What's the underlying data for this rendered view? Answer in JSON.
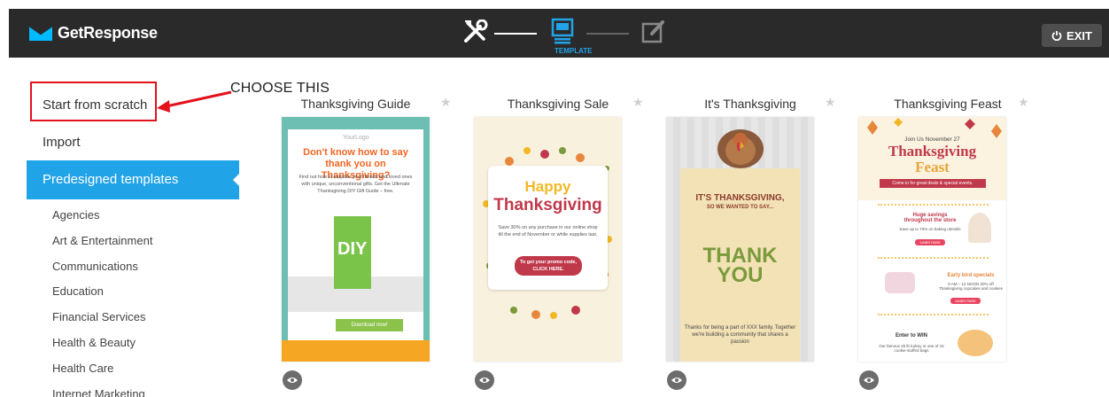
{
  "header": {
    "logo_text": "GetResponse",
    "step_active_label": "TEMPLATE",
    "exit_label": "EXIT",
    "colors": {
      "bar": "#2a2a2b",
      "accent": "#21a3e8"
    }
  },
  "sidebar": {
    "start_from_scratch": "Start from scratch",
    "import": "Import",
    "predesigned": "Predesigned templates",
    "categories": [
      "Agencies",
      "Art & Entertainment",
      "Communications",
      "Education",
      "Financial Services",
      "Health & Beauty",
      "Health Care",
      "Internet Marketing"
    ]
  },
  "annotation": {
    "text": "CHOOSE THIS",
    "color": "#e3111b"
  },
  "templates": [
    {
      "title": "Thanksgiving Guide",
      "logo": "YourLogo",
      "headline": "Don't know how to say thank you on Thanksgiving?",
      "body": "Find out how to surprise your friends and loved ones with unique, unconventional gifts. Get the Ultimate Thanksgiving DIY Gift Guide – free.",
      "book": "DIY",
      "cta": "Download now!"
    },
    {
      "title": "Thanksgiving Sale",
      "line1": "Happy",
      "line2": "Thanksgiving",
      "body": "Save 30% on any purchase in our online shop till the end of November or while supplies last.",
      "cta": "To get your promo code, CLICK HERE."
    },
    {
      "title": "It's Thanksgiving",
      "heading1": "IT'S THANKSGIVING,",
      "heading2": "SO WE WANTED TO SAY...",
      "thank": "THANK YOU",
      "body": "Thanks for being a part of XXX family. Together we're building a community that shares a passion"
    },
    {
      "title": "Thanksgiving Feast",
      "join": "Join Us November 27",
      "name1": "Thanksgiving",
      "name2": "Feast",
      "ribbon": "Come in for great deals & special events.",
      "sec1_title": "Huge savings throughout the store",
      "sec1_sub": "Save up to 70% on baking utensils",
      "sec2_title": "Early bird specials",
      "sec2_sub": "9 AM – 12 NOON 20% off Thanksgiving cupcakes and cookies",
      "sec3_title": "Enter to WIN",
      "sec3_sub": "Our famous 25 lb turkey or one of 15 cookie-stuffed bags",
      "learn": "Learn more"
    }
  ]
}
